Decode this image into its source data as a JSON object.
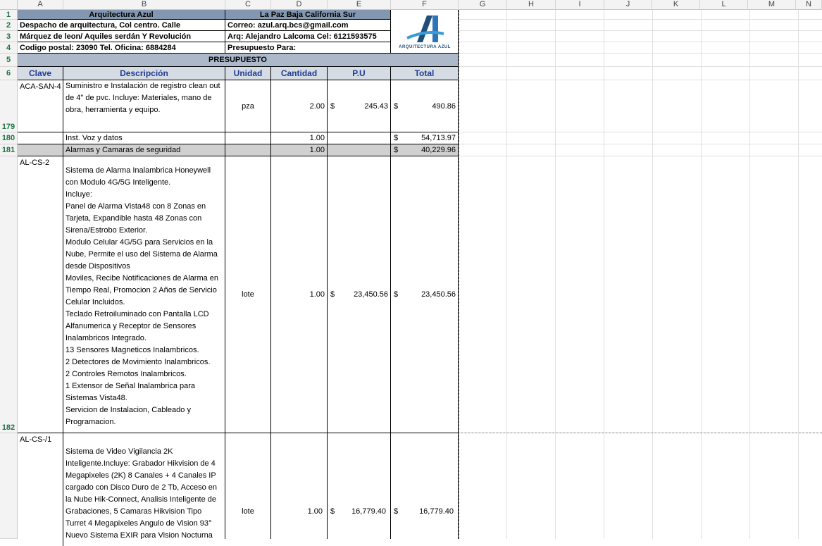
{
  "columns": [
    "A",
    "B",
    "C",
    "D",
    "E",
    "F",
    "G",
    "H",
    "I",
    "J",
    "K",
    "L",
    "M",
    "N"
  ],
  "rows": {
    "r1": "1",
    "r2": "2",
    "r3": "3",
    "r4": "4",
    "r5": "5",
    "r6": "6",
    "r179": "179",
    "r180": "180",
    "r181": "181",
    "r182": "182"
  },
  "header": {
    "company": "Arquitectura Azul",
    "location": "La Paz Baja California Sur",
    "address1": "Despacho de arquitectura, Col centro. Calle",
    "email": "Correo: azul.arq.bcs@gmail.com",
    "address2": "Márquez de leon/ Aquiles serdán Y Revolución",
    "architect": "Arq: Alejandro Lalcoma  Cel:  6121593575",
    "postal": "Codigo postal: 23090    Tel. Oficina: 6884284",
    "budget_for": "Presupuesto Para:",
    "logo_text": "ARQUITECTURA AZUL",
    "section_title": "PRESUPUESTO"
  },
  "table_headers": {
    "clave": "Clave",
    "descripcion": "Descripción",
    "unidad": "Unidad",
    "cantidad": "Cantidad",
    "pu": "P.U",
    "total": "Total"
  },
  "currency": "$",
  "items": {
    "r179": {
      "clave": "ACA-SAN-4",
      "descripcion": "Suministro e Instalación de registro clean out de 4\" de pvc. Incluye: Materiales, mano de obra, herramienta y equipo.",
      "unidad": "pza",
      "cantidad": "2.00",
      "pu": "245.43",
      "total": "490.86"
    },
    "r180": {
      "descripcion": "Inst. Voz y datos",
      "cantidad": "1.00",
      "total": "54,713.97"
    },
    "r181": {
      "descripcion": "Alarmas y Camaras de seguridad",
      "cantidad": "1.00",
      "total": "40,229.96"
    },
    "r182": {
      "clave": "AL-CS-2",
      "descripcion": "Sistema de Alarma Inalambrica Honeywell con Modulo 4G/5G Inteligente.\nIncluye:\nPanel de Alarma Vista48 con 8 Zonas en Tarjeta, Expandible hasta 48 Zonas con Sirena/Estrobo Exterior.\nModulo Celular 4G/5G para Servicios en la Nube, Permite el uso del Sistema de Alarma desde Dispositivos\nMoviles, Recibe Notificaciones de Alarma en Tiempo Real, Promocion 2 Años de Servicio Celular Incluidos.\nTeclado Retroiluminado con Pantalla LCD Alfanumerica y Receptor de Sensores Inalambricos Integrado.\n13 Sensores Magneticos Inalambricos.\n2 Detectores de Movimiento Inalambricos.\n2 Controles Remotos Inalambricos.\n1 Extensor de Señal Inalambrica para Sistemas Vista48.\nServicion de Instalacion, Cableado y Programacion.",
      "unidad": "lote",
      "cantidad": "1.00",
      "pu": "23,450.56",
      "total": "23,450.56"
    },
    "r183": {
      "clave": "AL-CS-/1",
      "descripcion": "Sistema de Video Vigilancia 2K Inteligente.Incluye: Grabador Hikvision de 4 Megapixeles (2K) 8 Canales + 4 Canales IP cargado con Disco Duro de 2 Tb, Acceso en la Nube Hik-Connect, Analisis Inteligente de Grabaciones, 5 Camaras Hikvision Tipo Turret 4 Megapixeles Angulo de Vision 93° Nuevo Sistema EXIR para Vision Nocturna",
      "unidad": "lote",
      "cantidad": "1.00",
      "pu": "16,779.40",
      "total": "16,779.40"
    }
  }
}
